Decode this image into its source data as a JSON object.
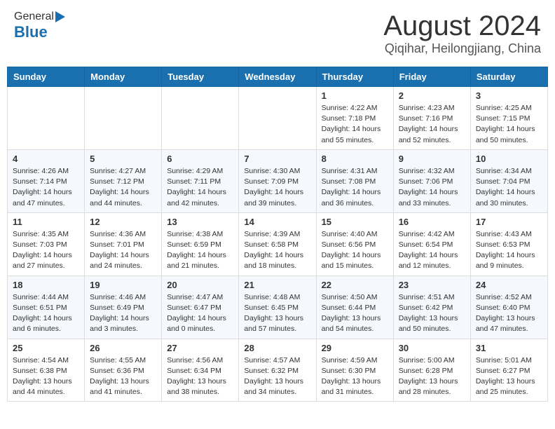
{
  "header": {
    "logo_general": "General",
    "logo_blue": "Blue",
    "month_year": "August 2024",
    "location": "Qiqihar, Heilongjiang, China"
  },
  "days_of_week": [
    "Sunday",
    "Monday",
    "Tuesday",
    "Wednesday",
    "Thursday",
    "Friday",
    "Saturday"
  ],
  "weeks": [
    [
      {
        "day": "",
        "info": ""
      },
      {
        "day": "",
        "info": ""
      },
      {
        "day": "",
        "info": ""
      },
      {
        "day": "",
        "info": ""
      },
      {
        "day": "1",
        "info": "Sunrise: 4:22 AM\nSunset: 7:18 PM\nDaylight: 14 hours\nand 55 minutes."
      },
      {
        "day": "2",
        "info": "Sunrise: 4:23 AM\nSunset: 7:16 PM\nDaylight: 14 hours\nand 52 minutes."
      },
      {
        "day": "3",
        "info": "Sunrise: 4:25 AM\nSunset: 7:15 PM\nDaylight: 14 hours\nand 50 minutes."
      }
    ],
    [
      {
        "day": "4",
        "info": "Sunrise: 4:26 AM\nSunset: 7:14 PM\nDaylight: 14 hours\nand 47 minutes."
      },
      {
        "day": "5",
        "info": "Sunrise: 4:27 AM\nSunset: 7:12 PM\nDaylight: 14 hours\nand 44 minutes."
      },
      {
        "day": "6",
        "info": "Sunrise: 4:29 AM\nSunset: 7:11 PM\nDaylight: 14 hours\nand 42 minutes."
      },
      {
        "day": "7",
        "info": "Sunrise: 4:30 AM\nSunset: 7:09 PM\nDaylight: 14 hours\nand 39 minutes."
      },
      {
        "day": "8",
        "info": "Sunrise: 4:31 AM\nSunset: 7:08 PM\nDaylight: 14 hours\nand 36 minutes."
      },
      {
        "day": "9",
        "info": "Sunrise: 4:32 AM\nSunset: 7:06 PM\nDaylight: 14 hours\nand 33 minutes."
      },
      {
        "day": "10",
        "info": "Sunrise: 4:34 AM\nSunset: 7:04 PM\nDaylight: 14 hours\nand 30 minutes."
      }
    ],
    [
      {
        "day": "11",
        "info": "Sunrise: 4:35 AM\nSunset: 7:03 PM\nDaylight: 14 hours\nand 27 minutes."
      },
      {
        "day": "12",
        "info": "Sunrise: 4:36 AM\nSunset: 7:01 PM\nDaylight: 14 hours\nand 24 minutes."
      },
      {
        "day": "13",
        "info": "Sunrise: 4:38 AM\nSunset: 6:59 PM\nDaylight: 14 hours\nand 21 minutes."
      },
      {
        "day": "14",
        "info": "Sunrise: 4:39 AM\nSunset: 6:58 PM\nDaylight: 14 hours\nand 18 minutes."
      },
      {
        "day": "15",
        "info": "Sunrise: 4:40 AM\nSunset: 6:56 PM\nDaylight: 14 hours\nand 15 minutes."
      },
      {
        "day": "16",
        "info": "Sunrise: 4:42 AM\nSunset: 6:54 PM\nDaylight: 14 hours\nand 12 minutes."
      },
      {
        "day": "17",
        "info": "Sunrise: 4:43 AM\nSunset: 6:53 PM\nDaylight: 14 hours\nand 9 minutes."
      }
    ],
    [
      {
        "day": "18",
        "info": "Sunrise: 4:44 AM\nSunset: 6:51 PM\nDaylight: 14 hours\nand 6 minutes."
      },
      {
        "day": "19",
        "info": "Sunrise: 4:46 AM\nSunset: 6:49 PM\nDaylight: 14 hours\nand 3 minutes."
      },
      {
        "day": "20",
        "info": "Sunrise: 4:47 AM\nSunset: 6:47 PM\nDaylight: 14 hours\nand 0 minutes."
      },
      {
        "day": "21",
        "info": "Sunrise: 4:48 AM\nSunset: 6:45 PM\nDaylight: 13 hours\nand 57 minutes."
      },
      {
        "day": "22",
        "info": "Sunrise: 4:50 AM\nSunset: 6:44 PM\nDaylight: 13 hours\nand 54 minutes."
      },
      {
        "day": "23",
        "info": "Sunrise: 4:51 AM\nSunset: 6:42 PM\nDaylight: 13 hours\nand 50 minutes."
      },
      {
        "day": "24",
        "info": "Sunrise: 4:52 AM\nSunset: 6:40 PM\nDaylight: 13 hours\nand 47 minutes."
      }
    ],
    [
      {
        "day": "25",
        "info": "Sunrise: 4:54 AM\nSunset: 6:38 PM\nDaylight: 13 hours\nand 44 minutes."
      },
      {
        "day": "26",
        "info": "Sunrise: 4:55 AM\nSunset: 6:36 PM\nDaylight: 13 hours\nand 41 minutes."
      },
      {
        "day": "27",
        "info": "Sunrise: 4:56 AM\nSunset: 6:34 PM\nDaylight: 13 hours\nand 38 minutes."
      },
      {
        "day": "28",
        "info": "Sunrise: 4:57 AM\nSunset: 6:32 PM\nDaylight: 13 hours\nand 34 minutes."
      },
      {
        "day": "29",
        "info": "Sunrise: 4:59 AM\nSunset: 6:30 PM\nDaylight: 13 hours\nand 31 minutes."
      },
      {
        "day": "30",
        "info": "Sunrise: 5:00 AM\nSunset: 6:28 PM\nDaylight: 13 hours\nand 28 minutes."
      },
      {
        "day": "31",
        "info": "Sunrise: 5:01 AM\nSunset: 6:27 PM\nDaylight: 13 hours\nand 25 minutes."
      }
    ]
  ]
}
